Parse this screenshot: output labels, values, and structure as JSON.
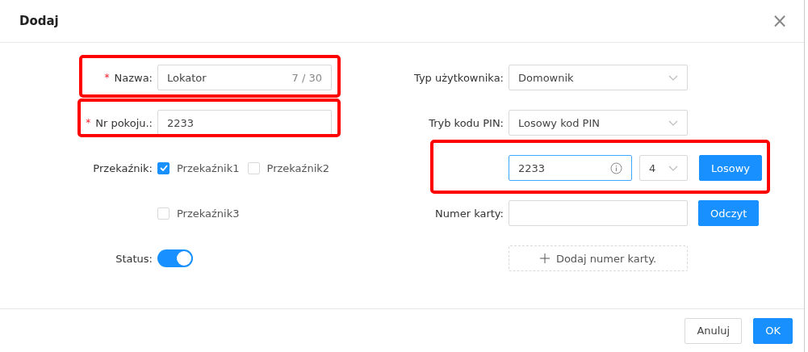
{
  "dialog": {
    "title": "Dodaj",
    "close": "×"
  },
  "left": {
    "name": {
      "label": "Nazwa:",
      "required_mark": "*",
      "value": "Lokator",
      "counter": "7 / 30",
      "highlighted": true
    },
    "room": {
      "label": "Nr pokoju.:",
      "required_mark": "*",
      "value": "2233",
      "highlighted": true
    },
    "relay": {
      "label": "Przekaźnik:",
      "options": [
        {
          "label": "Przekaźnik1",
          "checked": true
        },
        {
          "label": "Przekaźnik2",
          "checked": false
        },
        {
          "label": "Przekaźnik3",
          "checked": false
        }
      ]
    },
    "status": {
      "label": "Status:",
      "on": true
    }
  },
  "right": {
    "user_type": {
      "label": "Typ użytkownika:",
      "value": "Domownik"
    },
    "pin_mode": {
      "label": "Tryb kodu PIN:",
      "value": "Losowy kod PIN"
    },
    "pin": {
      "value": "2233",
      "length": "4",
      "button": "Losowy",
      "highlighted": true
    },
    "card": {
      "label": "Numer karty:",
      "button": "Odczyt"
    },
    "add_card": "Dodaj numer karty."
  },
  "buttons": [
    {
      "label": "Anuluj",
      "kind": "default"
    },
    {
      "label": "OK",
      "kind": "primary"
    }
  ]
}
